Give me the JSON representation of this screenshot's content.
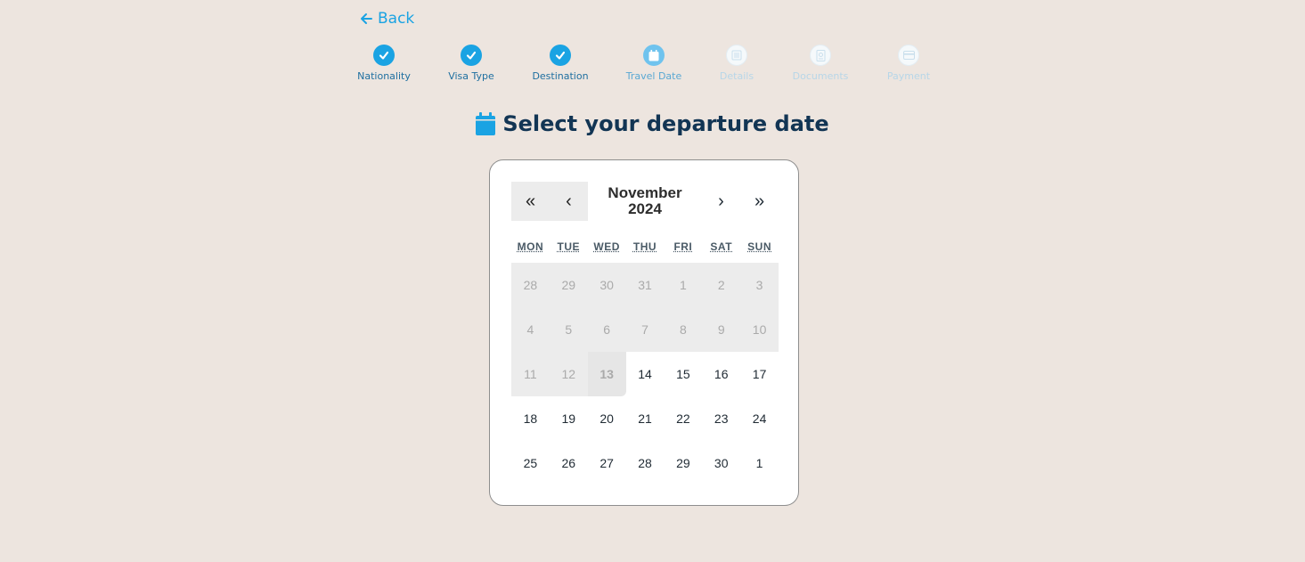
{
  "back": {
    "label": "Back"
  },
  "steps": [
    {
      "label": "Nationality",
      "state": "done",
      "icon": "check-icon"
    },
    {
      "label": "Visa Type",
      "state": "done",
      "icon": "check-icon"
    },
    {
      "label": "Destination",
      "state": "done",
      "icon": "check-icon"
    },
    {
      "label": "Travel Date",
      "state": "current",
      "icon": "calendar-icon"
    },
    {
      "label": "Details",
      "state": "future",
      "icon": "list-icon"
    },
    {
      "label": "Documents",
      "state": "future",
      "icon": "passport-icon"
    },
    {
      "label": "Payment",
      "state": "future",
      "icon": "credit-card-icon"
    }
  ],
  "heading": {
    "title": "Select your departure date",
    "icon": "calendar-icon"
  },
  "calendar": {
    "prev_year": "«",
    "prev_month": "‹",
    "next_month": "›",
    "next_year": "»",
    "month_label": "November",
    "year_label": "2024",
    "weekdays": [
      "MON",
      "TUE",
      "WED",
      "THU",
      "FRI",
      "SAT",
      "SUN"
    ],
    "weeks": [
      [
        {
          "d": "28",
          "disabled": true
        },
        {
          "d": "29",
          "disabled": true
        },
        {
          "d": "30",
          "disabled": true
        },
        {
          "d": "31",
          "disabled": true
        },
        {
          "d": "1",
          "disabled": true
        },
        {
          "d": "2",
          "disabled": true
        },
        {
          "d": "3",
          "disabled": true
        }
      ],
      [
        {
          "d": "4",
          "disabled": true
        },
        {
          "d": "5",
          "disabled": true
        },
        {
          "d": "6",
          "disabled": true
        },
        {
          "d": "7",
          "disabled": true
        },
        {
          "d": "8",
          "disabled": true
        },
        {
          "d": "9",
          "disabled": true
        },
        {
          "d": "10",
          "disabled": true
        }
      ],
      [
        {
          "d": "11",
          "disabled": true
        },
        {
          "d": "12",
          "disabled": true
        },
        {
          "d": "13",
          "disabled": true,
          "today": true
        },
        {
          "d": "14"
        },
        {
          "d": "15"
        },
        {
          "d": "16"
        },
        {
          "d": "17"
        }
      ],
      [
        {
          "d": "18"
        },
        {
          "d": "19"
        },
        {
          "d": "20"
        },
        {
          "d": "21"
        },
        {
          "d": "22"
        },
        {
          "d": "23"
        },
        {
          "d": "24"
        }
      ],
      [
        {
          "d": "25"
        },
        {
          "d": "26"
        },
        {
          "d": "27"
        },
        {
          "d": "28"
        },
        {
          "d": "29"
        },
        {
          "d": "30"
        },
        {
          "d": "1"
        }
      ]
    ]
  },
  "colors": {
    "accent": "#1aa3e3",
    "background": "#ede5df",
    "heading": "#123554"
  }
}
